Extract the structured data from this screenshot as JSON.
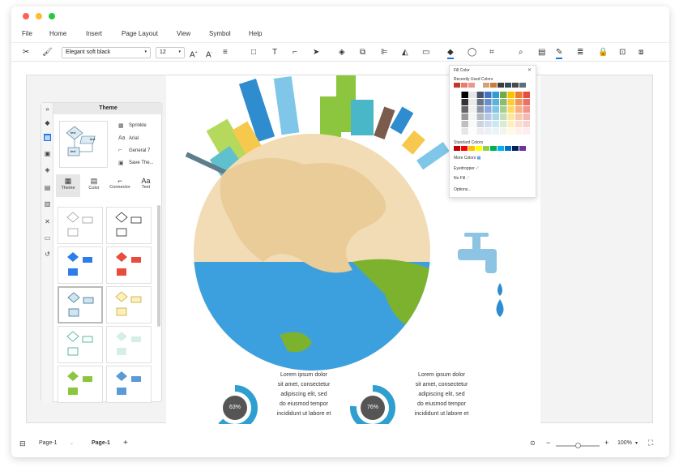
{
  "menu": [
    "File",
    "Home",
    "Insert",
    "Page Layout",
    "View",
    "Symbol",
    "Help"
  ],
  "toolbar": {
    "font": "Elegant soft black",
    "size": "12"
  },
  "sidepanel": {
    "title": "Theme",
    "props": [
      "Sprinkle",
      "Arial",
      "General 7",
      "Save The..."
    ],
    "preview_labels": [
      "text",
      "text",
      "text"
    ],
    "tabs": [
      "Theme",
      "Color",
      "Connector",
      "Text"
    ]
  },
  "fill_panel": {
    "title": "Fill Color",
    "recent_label": "Recently Used Colors",
    "standard_label": "Standard Colors",
    "more_colors": "More Colors",
    "eyedropper": "Eyedropper",
    "no_fill": "No Fill",
    "options": "Options..."
  },
  "canvas": {
    "text": "Lorem ipsum dolor sit amet, consectetur adipiscing elit, sed do eiusmod tempor incididunt ut labore et",
    "text_lines": [
      "Lorem ipsum dolor",
      "sit amet, consectetur",
      "adipiscing elit, sed",
      "do eiusmod tempor",
      "incididunt ut labore et"
    ],
    "percent1": "63%",
    "percent2": "76%"
  },
  "statusbar": {
    "page_selector": "Page-1",
    "page_tab": "Page-1",
    "zoom": "100%"
  },
  "colors": {
    "accent": "#1a73e8",
    "globe_ocean": "#3da0de",
    "globe_land": "#f2dcb5",
    "continent": "#e9cc97",
    "green": "#7cb22e",
    "faucet": "#8dc3e3"
  }
}
